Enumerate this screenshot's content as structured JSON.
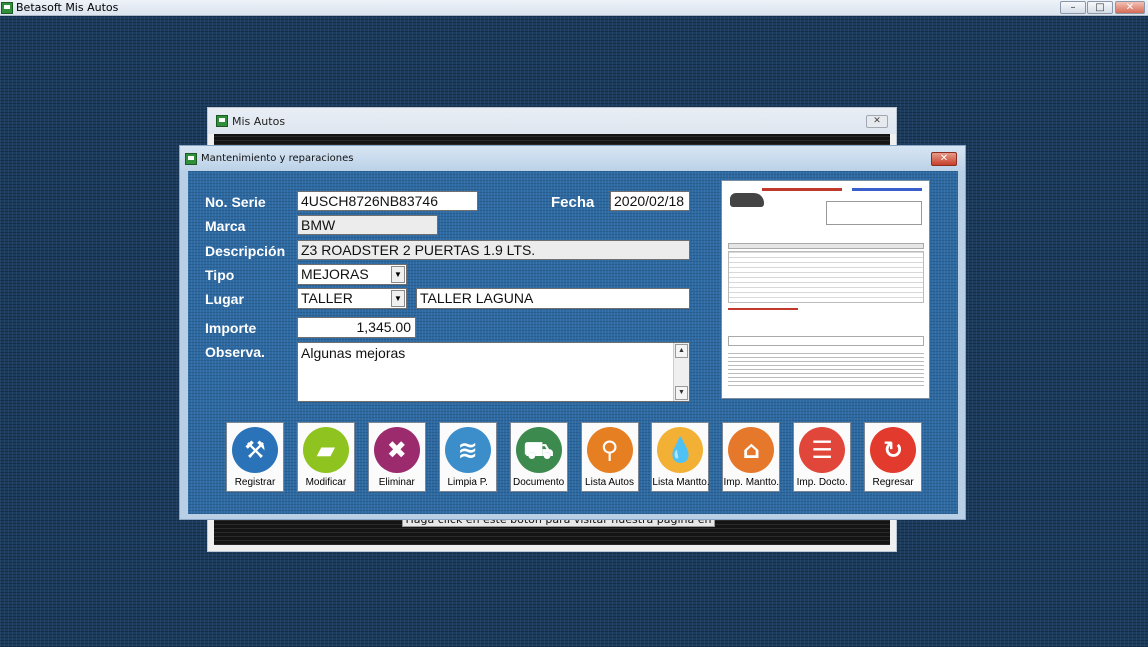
{
  "app": {
    "title": "Betasoft Mis Autos",
    "min": "–",
    "max": "□",
    "close": "✕"
  },
  "back_window": {
    "title": "Mis Autos",
    "close": "✕",
    "facebook_text": "Haga click en este botón para visitar nuestra página en Facebook"
  },
  "dialog": {
    "title": "Mantenimiento y reparaciones",
    "close": "✕"
  },
  "form": {
    "serie_label": "No. Serie",
    "serie_value": "4USCH8726NB83746",
    "fecha_label": "Fecha",
    "fecha_value": "2020/02/18",
    "marca_label": "Marca",
    "marca_value": "BMW",
    "descripcion_label": "Descripción",
    "descripcion_value": "Z3 ROADSTER 2 PUERTAS 1.9 LTS.",
    "tipo_label": "Tipo",
    "tipo_value": "MEJORAS",
    "lugar_label": "Lugar",
    "lugar_value": "TALLER",
    "lugar_detail": "TALLER LAGUNA",
    "importe_label": "Importe",
    "importe_value": "1,345.00",
    "observa_label": "Observa.",
    "observa_value": "Algunas mejoras"
  },
  "toolbar": [
    {
      "label": "Registrar",
      "icon": "tools-icon",
      "color": "#2b73b8",
      "glyph": "⚒"
    },
    {
      "label": "Modificar",
      "icon": "toolbox-icon",
      "color": "#8fc31f",
      "glyph": "▰"
    },
    {
      "label": "Eliminar",
      "icon": "x-icon",
      "color": "#9c2b6e",
      "glyph": "✖"
    },
    {
      "label": "Limpia P.",
      "icon": "car-wash-icon",
      "color": "#3b8ec9",
      "glyph": "≋"
    },
    {
      "label": "Documento",
      "icon": "car-icon",
      "color": "#3d8a4f",
      "glyph": "⛟"
    },
    {
      "label": "Lista Autos",
      "icon": "car-search-icon",
      "color": "#e67e22",
      "glyph": "⚲"
    },
    {
      "label": "Lista Mantto.",
      "icon": "oil-drop-icon",
      "color": "#f2b134",
      "glyph": "💧"
    },
    {
      "label": "Imp. Mantto.",
      "icon": "garage-icon",
      "color": "#e6782b",
      "glyph": "⌂"
    },
    {
      "label": "Imp. Docto.",
      "icon": "document-icon",
      "color": "#e0473a",
      "glyph": "☰"
    },
    {
      "label": "Regresar",
      "icon": "refresh-icon",
      "color": "#e23a2c",
      "glyph": "↻"
    }
  ]
}
